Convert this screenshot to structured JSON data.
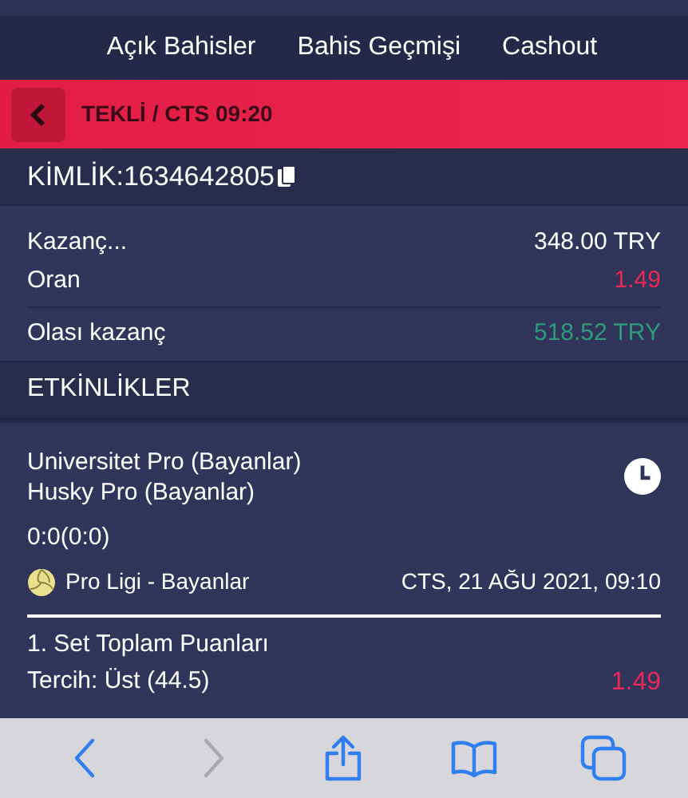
{
  "tabs": [
    {
      "label": "Açık Bahisler"
    },
    {
      "label": "Bahis Geçmişi"
    },
    {
      "label": "Cashout"
    }
  ],
  "header": {
    "title": "TEKLİ / CTS 09:20"
  },
  "ticket_id": "KİMLİK:1634642805",
  "summary": [
    {
      "label": "Kazanç...",
      "value": "348.00 TRY",
      "color": "#ffffff"
    },
    {
      "label": "Oran",
      "value": "1.49",
      "color": "#e8295a"
    },
    {
      "label": "Olası kazanç",
      "value": "518.52 TRY",
      "color": "#2f9a7c"
    }
  ],
  "section_title": "ETKİNLİKLER",
  "event": {
    "home": "Universitet Pro (Bayanlar)",
    "away": "Husky Pro (Bayanlar)",
    "score": "0:0(0:0)",
    "league": "Pro Ligi - Bayanlar",
    "date": "CTS, 21 AĞU 2021, 09:10",
    "market": "1. Set Toplam Puanları",
    "pick": "Tercih: Üst (44.5)",
    "odds": "1.49"
  },
  "browser_toolbar": [
    {
      "kind": "back",
      "disabled": false
    },
    {
      "kind": "forward",
      "disabled": true
    },
    {
      "kind": "share",
      "disabled": false
    },
    {
      "kind": "bookmarks",
      "disabled": false
    },
    {
      "kind": "tabs",
      "disabled": false
    }
  ]
}
